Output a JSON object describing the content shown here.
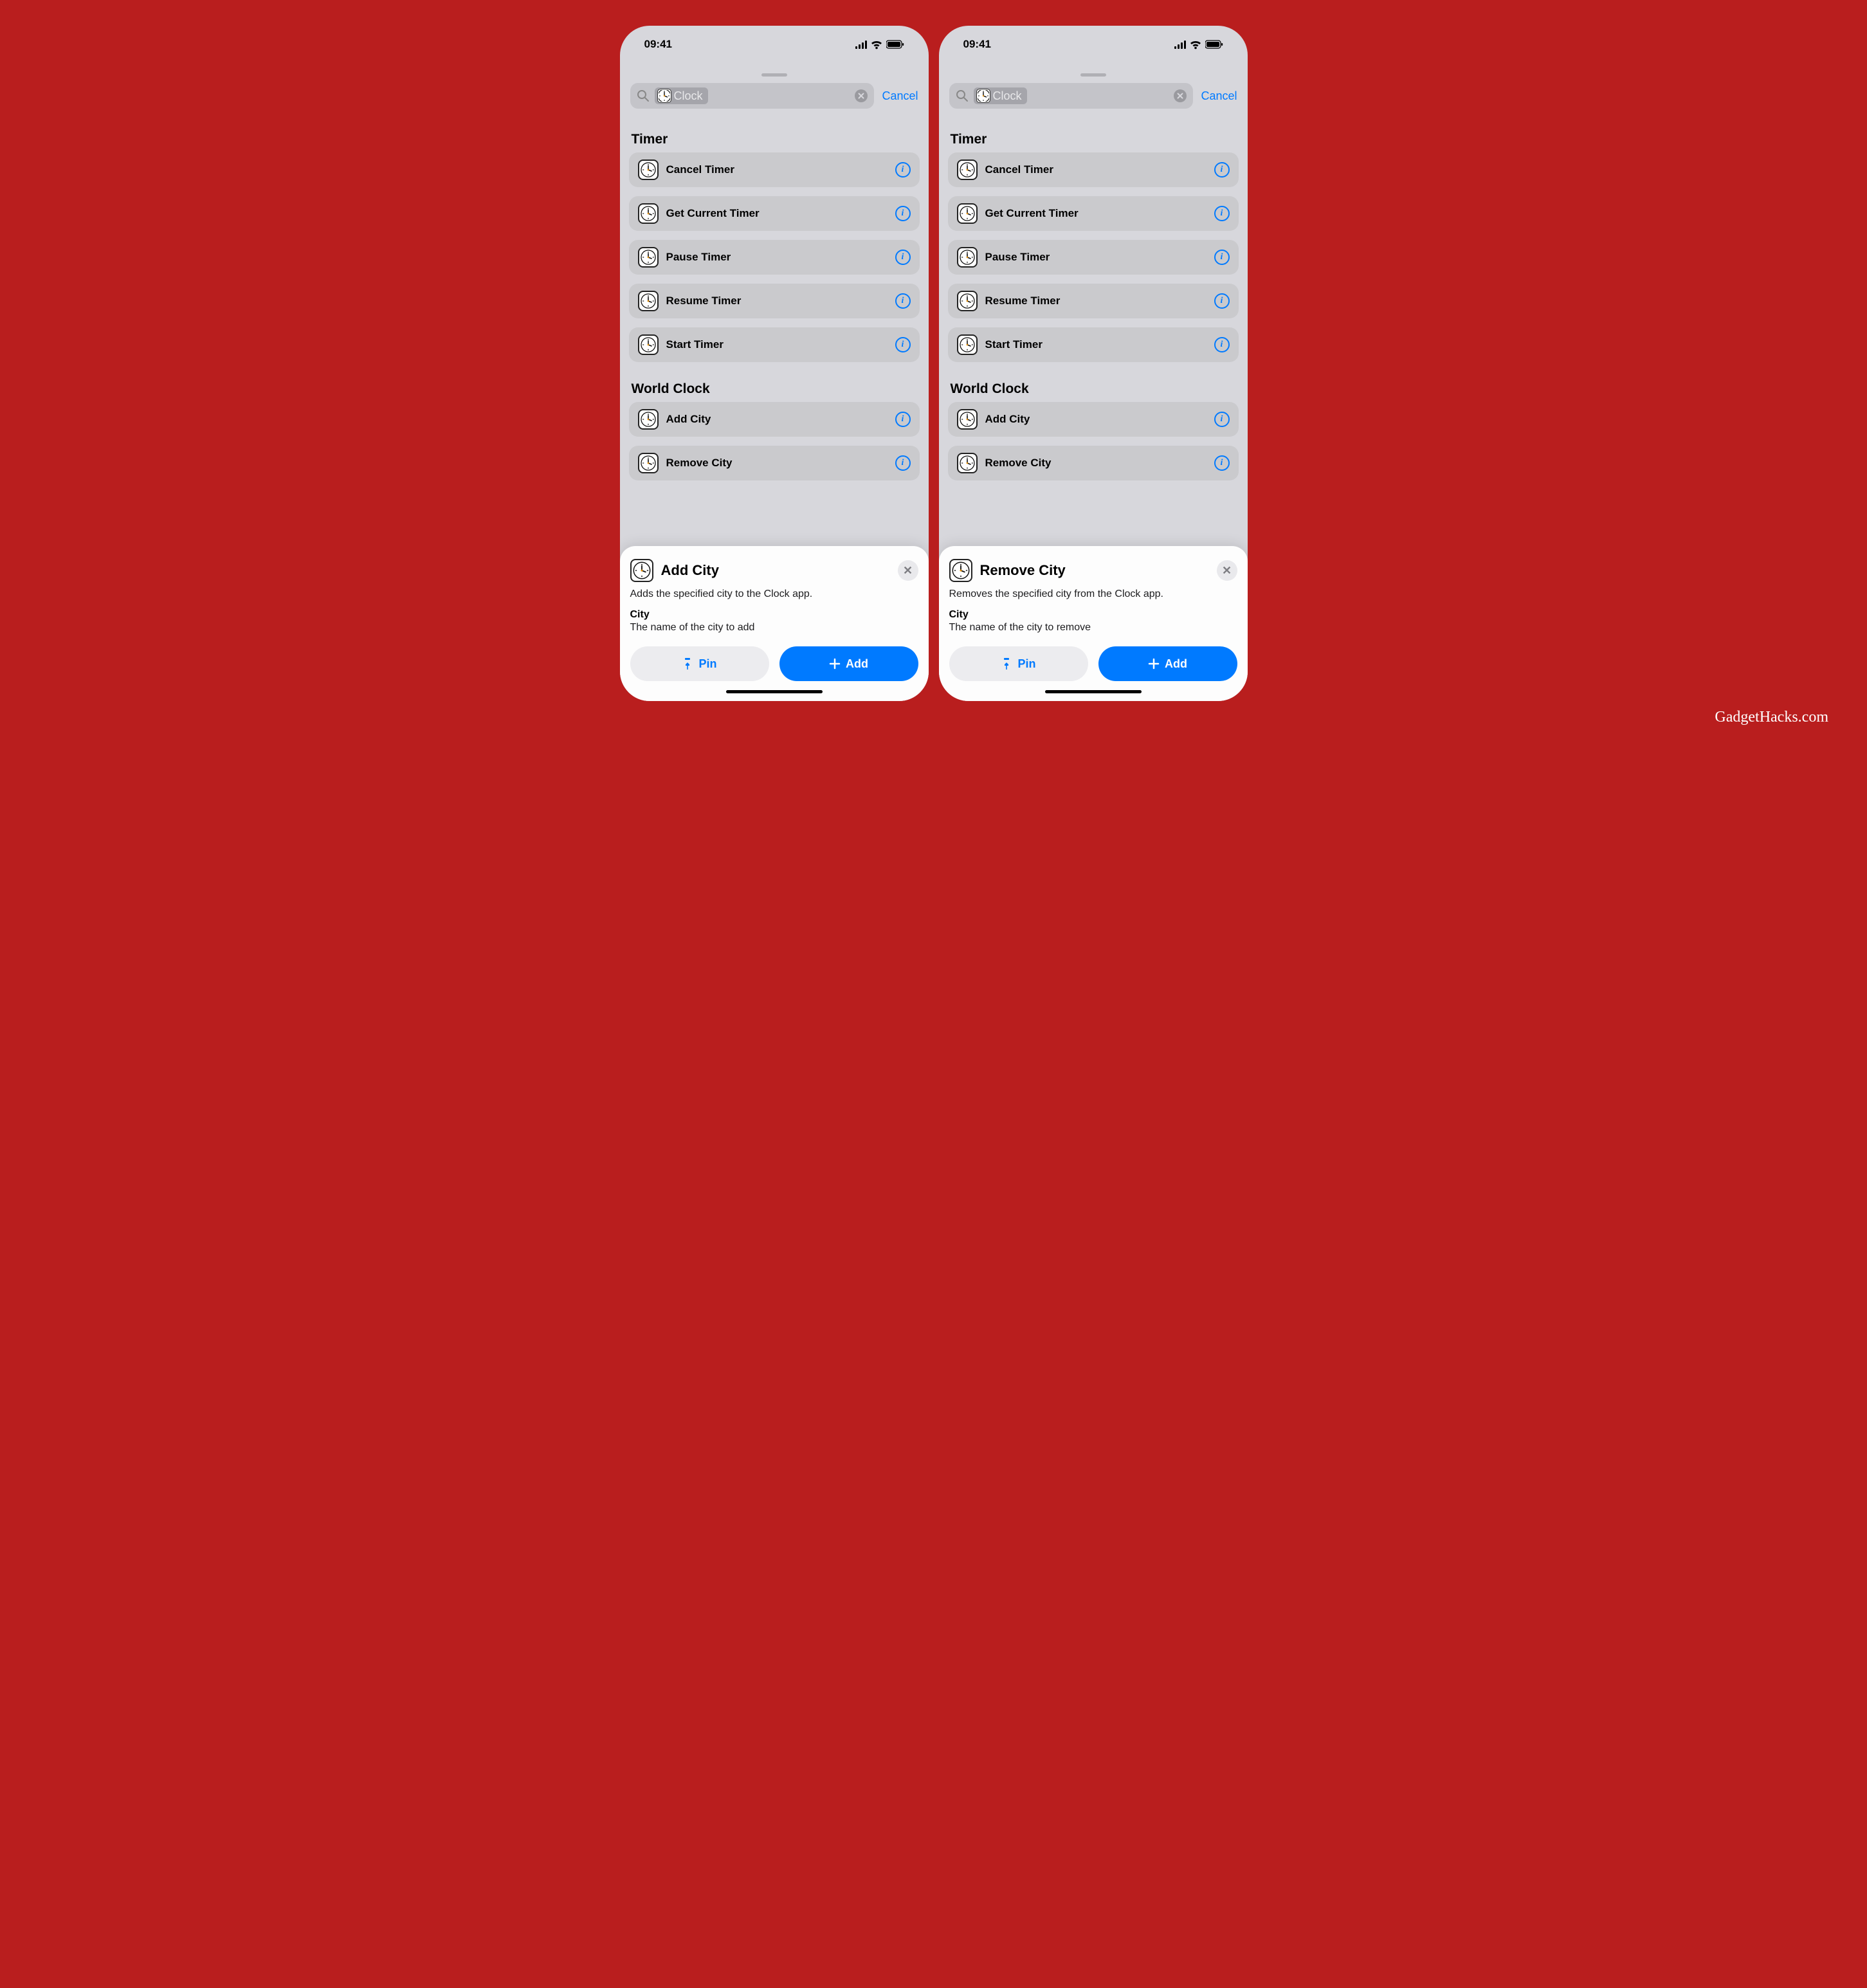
{
  "status": {
    "time": "09:41"
  },
  "search": {
    "cancel": "Cancel",
    "token": "Clock"
  },
  "sections": {
    "timer": {
      "title": "Timer",
      "rows": {
        "cancel": "Cancel Timer",
        "get_current": "Get Current Timer",
        "pause": "Pause Timer",
        "resume": "Resume Timer",
        "start": "Start Timer"
      }
    },
    "world": {
      "title": "World Clock",
      "rows": {
        "add": "Add City",
        "remove": "Remove City"
      }
    }
  },
  "detail_left": {
    "title": "Add City",
    "desc": "Adds the specified city to the Clock app.",
    "param_label": "City",
    "param_desc": "The name of the city to add",
    "pin": "Pin",
    "add": "Add"
  },
  "detail_right": {
    "title": "Remove City",
    "desc": "Removes the specified city from the Clock app.",
    "param_label": "City",
    "param_desc": "The name of the city to remove",
    "pin": "Pin",
    "add": "Add"
  },
  "watermark": "GadgetHacks.com"
}
